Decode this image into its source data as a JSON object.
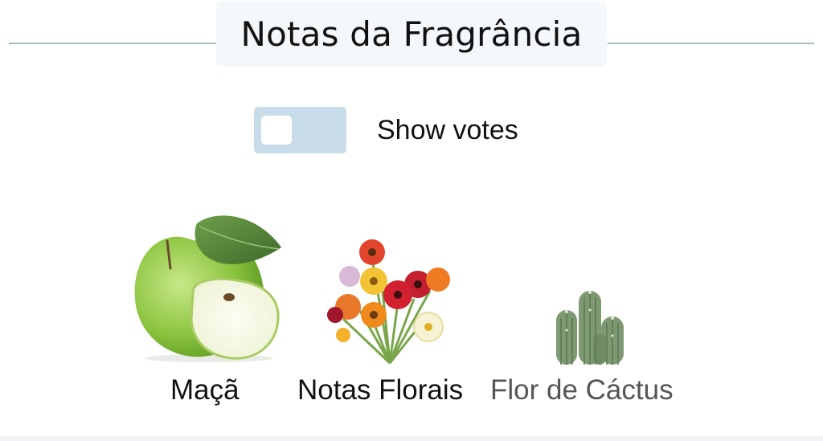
{
  "section": {
    "title": "Notas da Fragrância"
  },
  "votes_toggle": {
    "label": "Show votes",
    "checked": false
  },
  "notes": [
    {
      "label": "Maçã",
      "icon": "green-apple-image",
      "color": "#111111"
    },
    {
      "label": "Notas Florais",
      "icon": "flower-bouquet-image",
      "color": "#111111"
    },
    {
      "label": "Flor de Cáctus",
      "icon": "cactus-image",
      "color": "#555555"
    }
  ]
}
